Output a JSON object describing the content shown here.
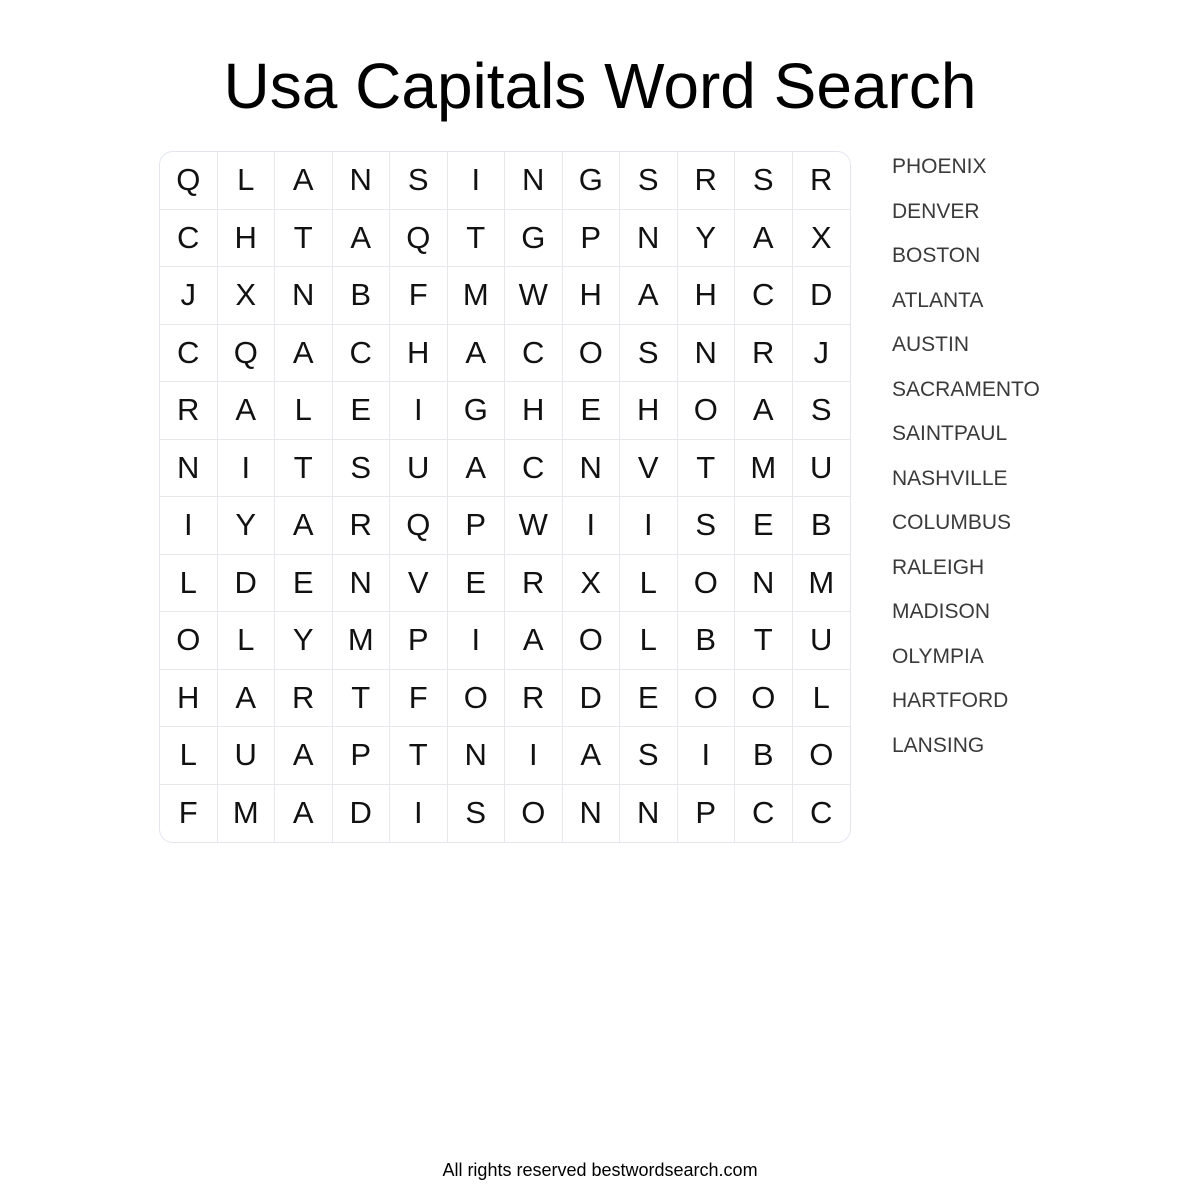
{
  "title": "Usa Capitals Word Search",
  "grid": {
    "rows": [
      [
        "Q",
        "L",
        "A",
        "N",
        "S",
        "I",
        "N",
        "G",
        "S",
        "R",
        "S",
        "R"
      ],
      [
        "C",
        "H",
        "T",
        "A",
        "Q",
        "T",
        "G",
        "P",
        "N",
        "Y",
        "A",
        "X"
      ],
      [
        "J",
        "X",
        "N",
        "B",
        "F",
        "M",
        "W",
        "H",
        "A",
        "H",
        "C",
        "D"
      ],
      [
        "C",
        "Q",
        "A",
        "C",
        "H",
        "A",
        "C",
        "O",
        "S",
        "N",
        "R",
        "J"
      ],
      [
        "R",
        "A",
        "L",
        "E",
        "I",
        "G",
        "H",
        "E",
        "H",
        "O",
        "A",
        "S"
      ],
      [
        "N",
        "I",
        "T",
        "S",
        "U",
        "A",
        "C",
        "N",
        "V",
        "T",
        "M",
        "U"
      ],
      [
        "I",
        "Y",
        "A",
        "R",
        "Q",
        "P",
        "W",
        "I",
        "I",
        "S",
        "E",
        "B"
      ],
      [
        "L",
        "D",
        "E",
        "N",
        "V",
        "E",
        "R",
        "X",
        "L",
        "O",
        "N",
        "M"
      ],
      [
        "O",
        "L",
        "Y",
        "M",
        "P",
        "I",
        "A",
        "O",
        "L",
        "B",
        "T",
        "U"
      ],
      [
        "H",
        "A",
        "R",
        "T",
        "F",
        "O",
        "R",
        "D",
        "E",
        "O",
        "O",
        "L"
      ],
      [
        "L",
        "U",
        "A",
        "P",
        "T",
        "N",
        "I",
        "A",
        "S",
        "I",
        "B",
        "O"
      ],
      [
        "F",
        "M",
        "A",
        "D",
        "I",
        "S",
        "O",
        "N",
        "N",
        "P",
        "C",
        "C"
      ]
    ]
  },
  "words": [
    "PHOENIX",
    "DENVER",
    "BOSTON",
    "ATLANTA",
    "AUSTIN",
    "SACRAMENTO",
    "SAINTPAUL",
    "NASHVILLE",
    "COLUMBUS",
    "RALEIGH",
    "MADISON",
    "OLYMPIA",
    "HARTFORD",
    "LANSING"
  ],
  "footer": "All rights reserved bestwordsearch.com"
}
